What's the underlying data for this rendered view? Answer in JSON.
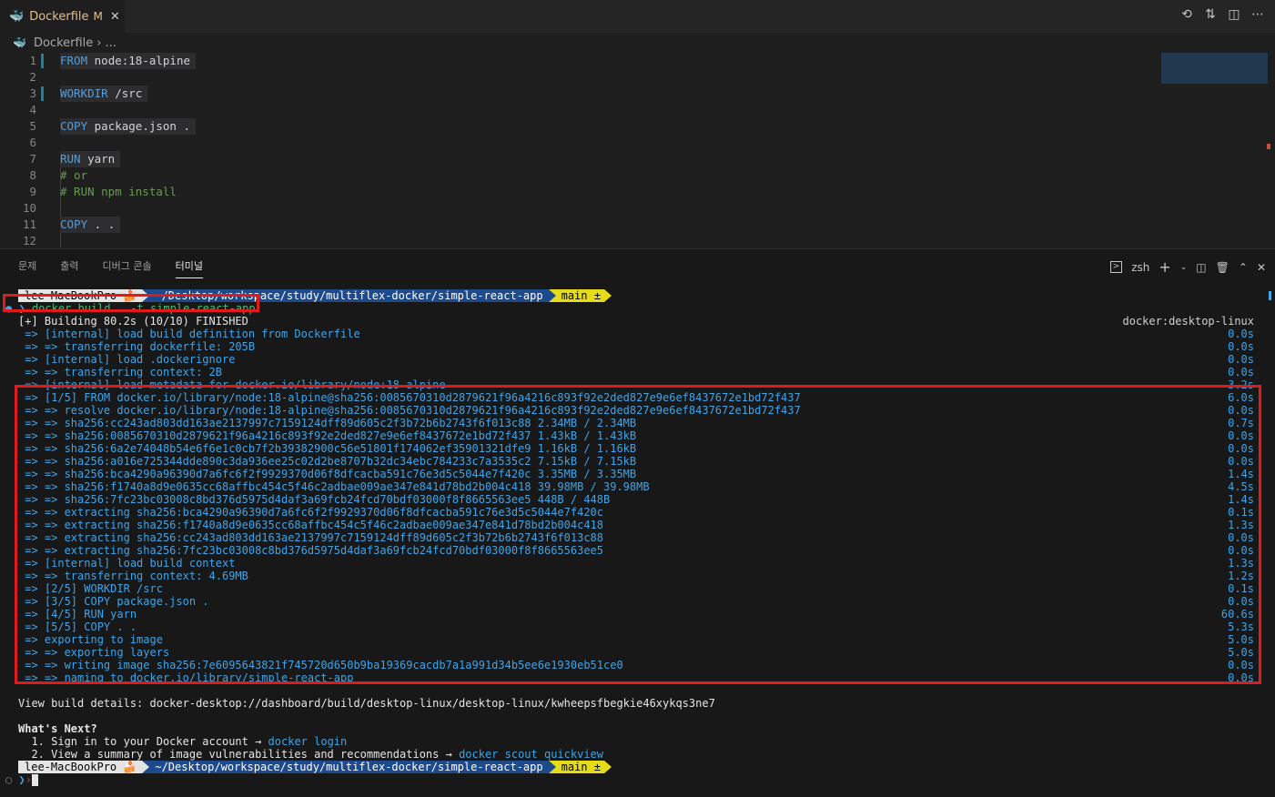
{
  "tab": {
    "filename": "Dockerfile",
    "modified": "M",
    "close": "✕"
  },
  "breadcrumb": {
    "file": "Dockerfile",
    "separator": "›",
    "ellipsis": "..."
  },
  "code": [
    {
      "n": "1",
      "kw": "FROM",
      "rest": "node:18-alpine"
    },
    {
      "n": "2",
      "kw": "",
      "rest": ""
    },
    {
      "n": "3",
      "kw": "WORKDIR",
      "rest": "/src"
    },
    {
      "n": "4",
      "kw": "",
      "rest": ""
    },
    {
      "n": "5",
      "kw": "COPY",
      "rest": "package.json ."
    },
    {
      "n": "6",
      "kw": "",
      "rest": ""
    },
    {
      "n": "7",
      "kw": "RUN",
      "rest": "yarn"
    },
    {
      "n": "8",
      "kw": "",
      "rest": "# or"
    },
    {
      "n": "9",
      "kw": "",
      "rest": "# RUN npm install"
    },
    {
      "n": "10",
      "kw": "",
      "rest": ""
    },
    {
      "n": "11",
      "kw": "COPY",
      "rest": ". ."
    },
    {
      "n": "12",
      "kw": "",
      "rest": ""
    }
  ],
  "panel": {
    "tabs": [
      "문제",
      "출력",
      "디버그 콘솔",
      "터미널"
    ],
    "active_tab": "터미널",
    "shell": "zsh"
  },
  "prompt": {
    "host": "lee-MacBookPro",
    "host_emoji": "🍰",
    "path": "~/Desktop/workspace/study/multiflex-docker/simple-react-app",
    "git": " main ±"
  },
  "terminal": {
    "command": "docker build . -t simple-react-app",
    "header": "[+] Building 80.2s (10/10) FINISHED",
    "builder": "docker:desktop-linux",
    "lines": [
      {
        "t": " => [internal] load build definition from Dockerfile",
        "time": "0.0s"
      },
      {
        "t": " => => transferring dockerfile: 205B",
        "time": "0.0s"
      },
      {
        "t": " => [internal] load .dockerignore",
        "time": "0.0s"
      },
      {
        "t": " => => transferring context: 2B",
        "time": "0.0s"
      },
      {
        "t": " => [internal] load metadata for docker.io/library/node:18-alpine",
        "time": "3.2s"
      },
      {
        "t": " => [1/5] FROM docker.io/library/node:18-alpine@sha256:0085670310d2879621f96a4216c893f92e2ded827e9e6ef8437672e1bd72f437",
        "time": "6.0s"
      },
      {
        "t": " => => resolve docker.io/library/node:18-alpine@sha256:0085670310d2879621f96a4216c893f92e2ded827e9e6ef8437672e1bd72f437",
        "time": "0.0s"
      },
      {
        "t": " => => sha256:cc243ad803dd163ae2137997c7159124dff89d605c2f3b72b6b2743f6f013c88 2.34MB / 2.34MB",
        "time": "0.7s"
      },
      {
        "t": " => => sha256:0085670310d2879621f96a4216c893f92e2ded827e9e6ef8437672e1bd72f437 1.43kB / 1.43kB",
        "time": "0.0s"
      },
      {
        "t": " => => sha256:6a2e74048b54e6f6e1c0cb7f2b39382900c56e51801f174062ef35901321dfe9 1.16kB / 1.16kB",
        "time": "0.0s"
      },
      {
        "t": " => => sha256:a016e725344dde890c3da936ee25c02d2be8707b32dc34ebc784233c7a3535c2 7.15kB / 7.15kB",
        "time": "0.0s"
      },
      {
        "t": " => => sha256:bca4290a96390d7a6fc6f2f9929370d06f8dfcacba591c76e3d5c5044e7f420c 3.35MB / 3.35MB",
        "time": "1.4s"
      },
      {
        "t": " => => sha256:f1740a8d9e0635cc68affbc454c5f46c2adbae009ae347e841d78bd2b004c418 39.98MB / 39.98MB",
        "time": "4.5s"
      },
      {
        "t": " => => sha256:7fc23bc03008c8bd376d5975d4daf3a69fcb24fcd70bdf03000f8f8665563ee5 448B / 448B",
        "time": "1.4s"
      },
      {
        "t": " => => extracting sha256:bca4290a96390d7a6fc6f2f9929370d06f8dfcacba591c76e3d5c5044e7f420c",
        "time": "0.1s"
      },
      {
        "t": " => => extracting sha256:f1740a8d9e0635cc68affbc454c5f46c2adbae009ae347e841d78bd2b004c418",
        "time": "1.3s"
      },
      {
        "t": " => => extracting sha256:cc243ad803dd163ae2137997c7159124dff89d605c2f3b72b6b2743f6f013c88",
        "time": "0.0s"
      },
      {
        "t": " => => extracting sha256:7fc23bc03008c8bd376d5975d4daf3a69fcb24fcd70bdf03000f8f8665563ee5",
        "time": "0.0s"
      },
      {
        "t": " => [internal] load build context",
        "time": "1.3s"
      },
      {
        "t": " => => transferring context: 4.69MB",
        "time": "1.2s"
      },
      {
        "t": " => [2/5] WORKDIR /src",
        "time": "0.1s"
      },
      {
        "t": " => [3/5] COPY package.json .",
        "time": "0.0s"
      },
      {
        "t": " => [4/5] RUN yarn",
        "time": "60.6s"
      },
      {
        "t": " => [5/5] COPY . .",
        "time": "5.3s"
      },
      {
        "t": " => exporting to image",
        "time": "5.0s"
      },
      {
        "t": " => => exporting layers",
        "time": "5.0s"
      },
      {
        "t": " => => writing image sha256:7e6095643821f745720d650b9ba19369cacdb7a1a991d34b5ee6e1930eb51ce0",
        "time": "0.0s"
      },
      {
        "t": " => => naming to docker.io/library/simple-react-app",
        "time": "0.0s"
      }
    ],
    "details": "View build details: docker-desktop://dashboard/build/desktop-linux/desktop-linux/kwheepsfbegkie46xykqs3ne7",
    "next_title": "What's Next?",
    "next1_text": "  1. Sign in to your Docker account → ",
    "next1_cmd": "docker login",
    "next2_text": "  2. View a summary of image vulnerabilities and recommendations → ",
    "next2_cmd": "docker scout quickview"
  },
  "colors": {
    "accent": "#3fa4e8",
    "highlight_box": "#e01b1b",
    "path_bg": "#1d4a8c",
    "git_bg": "#e6db19"
  }
}
